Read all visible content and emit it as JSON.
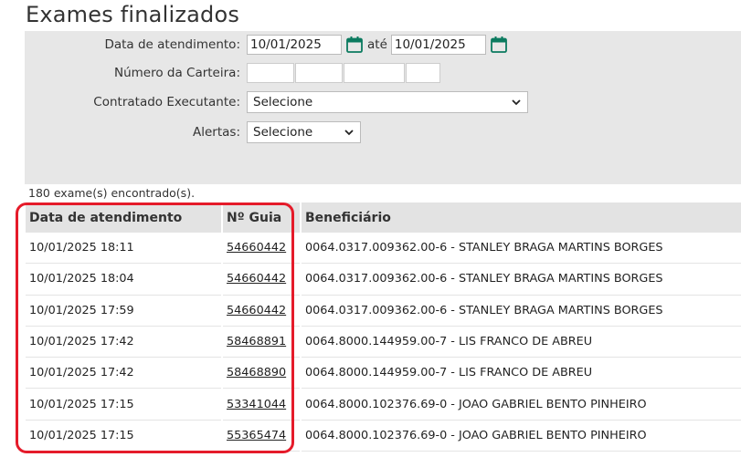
{
  "page": {
    "title": "Exames finalizados"
  },
  "filters": {
    "date_label": "Data de atendimento:",
    "date_from": "10/01/2025",
    "date_sep": "até",
    "date_to": "10/01/2025",
    "card_label": "Número da Carteira:",
    "contractor_label": "Contratado Executante:",
    "contractor_value": "Selecione",
    "alerts_label": "Alertas:",
    "alerts_value": "Selecione"
  },
  "results": {
    "count": "180 exame(s) encontrado(s).",
    "headers": [
      "Data de atendimento",
      "Nº Guia",
      "Beneficiário"
    ],
    "rows": [
      {
        "date": "10/01/2025 18:11",
        "guia": "54660442",
        "beneficiary": "0064.0317.009362.00-6 - STANLEY BRAGA MARTINS BORGES"
      },
      {
        "date": "10/01/2025 18:04",
        "guia": "54660442",
        "beneficiary": "0064.0317.009362.00-6 - STANLEY BRAGA MARTINS BORGES"
      },
      {
        "date": "10/01/2025 17:59",
        "guia": "54660442",
        "beneficiary": "0064.0317.009362.00-6 - STANLEY BRAGA MARTINS BORGES"
      },
      {
        "date": "10/01/2025 17:42",
        "guia": "58468891",
        "beneficiary": "0064.8000.144959.00-7 - LIS FRANCO DE ABREU"
      },
      {
        "date": "10/01/2025 17:42",
        "guia": "58468890",
        "beneficiary": "0064.8000.144959.00-7 - LIS FRANCO DE ABREU"
      },
      {
        "date": "10/01/2025 17:15",
        "guia": "53341044",
        "beneficiary": "0064.8000.102376.69-0 - JOAO GABRIEL BENTO PINHEIRO"
      },
      {
        "date": "10/01/2025 17:15",
        "guia": "55365474",
        "beneficiary": "0064.8000.102376.69-0 - JOAO GABRIEL BENTO PINHEIRO"
      }
    ]
  },
  "colors": {
    "accent": "#0b7a5f",
    "highlight": "#e51b2a",
    "panel_bg": "#e7e7e7"
  },
  "icons": {
    "calendar": "calendar-icon",
    "dropdown": "chevron-down-icon"
  }
}
